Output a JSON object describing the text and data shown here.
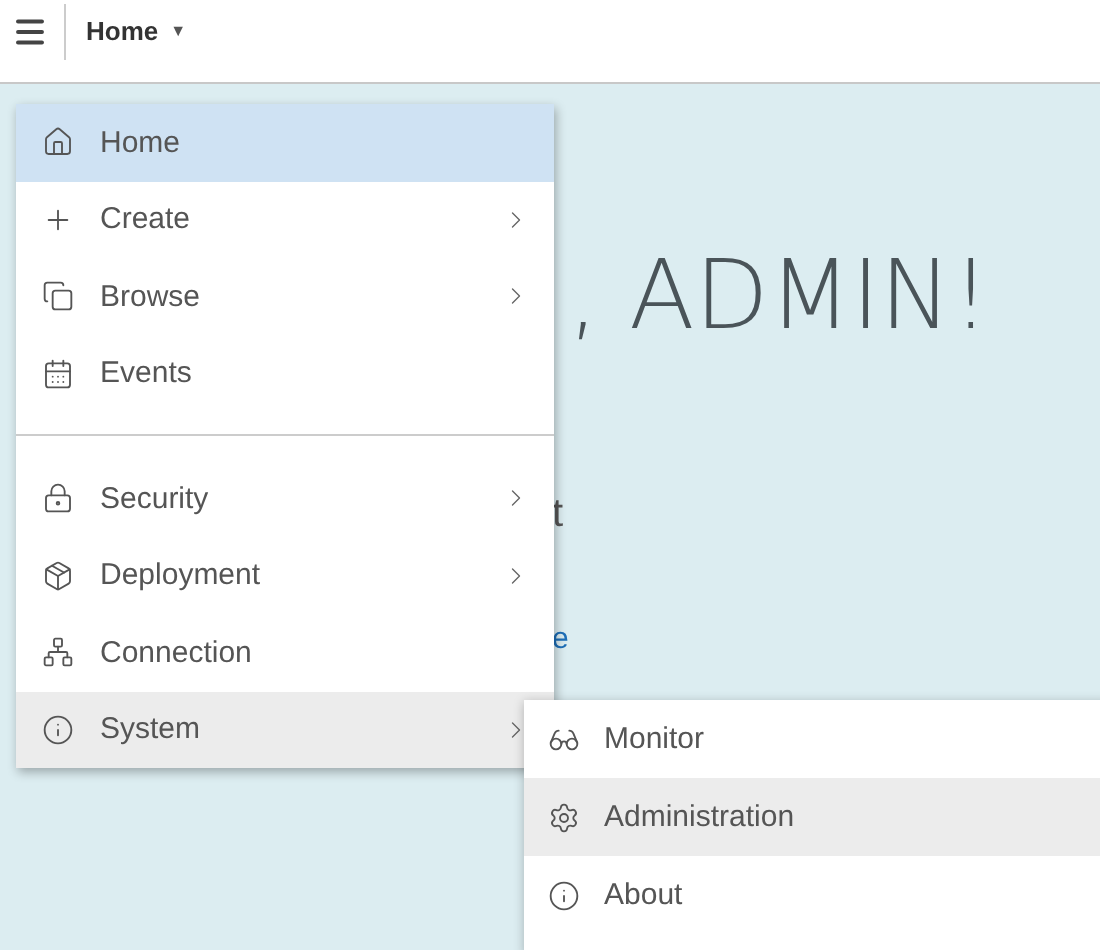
{
  "top_bar": {
    "breadcrumb": "Home",
    "breadcrumb_caret": "▼"
  },
  "background": {
    "heading": ", ADMIN!",
    "line_fragment": "t",
    "link_fragment": "e"
  },
  "menu": {
    "items": [
      {
        "kind": "item",
        "label": "Home",
        "selected": true,
        "submenu": false,
        "expanded": false
      },
      {
        "kind": "item",
        "label": "Create",
        "selected": false,
        "submenu": true,
        "expanded": false
      },
      {
        "kind": "item",
        "label": "Browse",
        "selected": false,
        "submenu": true,
        "expanded": false
      },
      {
        "kind": "item",
        "label": "Events",
        "selected": false,
        "submenu": false,
        "expanded": false
      },
      {
        "kind": "divider"
      },
      {
        "kind": "item",
        "label": "Security",
        "selected": false,
        "submenu": true,
        "expanded": false
      },
      {
        "kind": "item",
        "label": "Deployment",
        "selected": false,
        "submenu": true,
        "expanded": false
      },
      {
        "kind": "item",
        "label": "Connection",
        "selected": false,
        "submenu": false,
        "expanded": false
      },
      {
        "kind": "item",
        "label": "System",
        "selected": false,
        "submenu": true,
        "expanded": true
      }
    ]
  },
  "submenu": {
    "items": [
      {
        "label": "Monitor",
        "highlighted": false
      },
      {
        "label": "Administration",
        "highlighted": true
      },
      {
        "label": "About",
        "highlighted": false
      }
    ]
  }
}
